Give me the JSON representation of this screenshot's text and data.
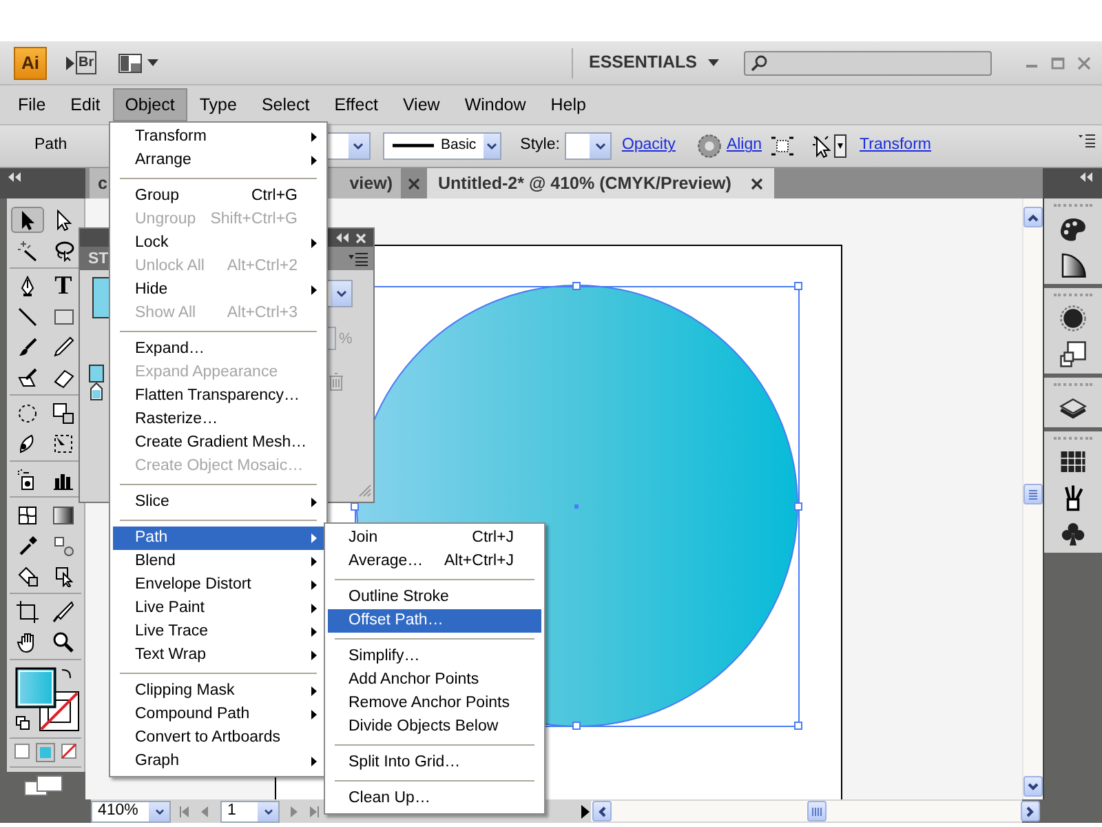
{
  "app_bar": {
    "logo": "Ai",
    "bridge": "Br",
    "workspace": "ESSENTIALS"
  },
  "menu_bar": [
    {
      "label": "File",
      "selected": false
    },
    {
      "label": "Edit",
      "selected": false
    },
    {
      "label": "Object",
      "selected": true
    },
    {
      "label": "Type",
      "selected": false
    },
    {
      "label": "Select",
      "selected": false
    },
    {
      "label": "Effect",
      "selected": false
    },
    {
      "label": "View",
      "selected": false
    },
    {
      "label": "Window",
      "selected": false
    },
    {
      "label": "Help",
      "selected": false
    }
  ],
  "control_bar": {
    "selection": "Path",
    "stroke_style": "Basic",
    "style_label": "Style:",
    "links": [
      "Opacity",
      "Align",
      "Transform"
    ]
  },
  "doc_tabs": [
    {
      "label_start": "c",
      "label_end": "view)",
      "selected": false
    },
    {
      "label": "Untitled-2* @ 410% (CMYK/Preview)",
      "selected": true
    }
  ],
  "type_tool_glyph": "T",
  "floating_panel": {
    "title": "ST",
    "percent_sign": "%"
  },
  "object_menu": [
    {
      "kind": "item",
      "label": "Transform",
      "submenu": true,
      "disabled": false,
      "selected": false
    },
    {
      "kind": "item",
      "label": "Arrange",
      "submenu": true,
      "disabled": false,
      "selected": false
    },
    {
      "kind": "separator"
    },
    {
      "kind": "item",
      "label": "Group",
      "shortcut": "Ctrl+G",
      "submenu": false,
      "disabled": false,
      "selected": false
    },
    {
      "kind": "item",
      "label": "Ungroup",
      "shortcut": "Shift+Ctrl+G",
      "submenu": false,
      "disabled": true,
      "selected": false
    },
    {
      "kind": "item",
      "label": "Lock",
      "submenu": true,
      "disabled": false,
      "selected": false
    },
    {
      "kind": "item",
      "label": "Unlock All",
      "shortcut": "Alt+Ctrl+2",
      "submenu": false,
      "disabled": true,
      "selected": false
    },
    {
      "kind": "item",
      "label": "Hide",
      "submenu": true,
      "disabled": false,
      "selected": false
    },
    {
      "kind": "item",
      "label": "Show All",
      "shortcut": "Alt+Ctrl+3",
      "submenu": false,
      "disabled": true,
      "selected": false
    },
    {
      "kind": "separator"
    },
    {
      "kind": "item",
      "label": "Expand…",
      "submenu": false,
      "disabled": false,
      "selected": false
    },
    {
      "kind": "item",
      "label": "Expand Appearance",
      "submenu": false,
      "disabled": true,
      "selected": false
    },
    {
      "kind": "item",
      "label": "Flatten Transparency…",
      "submenu": false,
      "disabled": false,
      "selected": false
    },
    {
      "kind": "item",
      "label": "Rasterize…",
      "submenu": false,
      "disabled": false,
      "selected": false
    },
    {
      "kind": "item",
      "label": "Create Gradient Mesh…",
      "submenu": false,
      "disabled": false,
      "selected": false
    },
    {
      "kind": "item",
      "label": "Create Object Mosaic…",
      "submenu": false,
      "disabled": true,
      "selected": false
    },
    {
      "kind": "separator"
    },
    {
      "kind": "item",
      "label": "Slice",
      "submenu": true,
      "disabled": false,
      "selected": false
    },
    {
      "kind": "separator"
    },
    {
      "kind": "item",
      "label": "Path",
      "submenu": true,
      "disabled": false,
      "selected": true
    },
    {
      "kind": "item",
      "label": "Blend",
      "submenu": true,
      "disabled": false,
      "selected": false
    },
    {
      "kind": "item",
      "label": "Envelope Distort",
      "submenu": true,
      "disabled": false,
      "selected": false
    },
    {
      "kind": "item",
      "label": "Live Paint",
      "submenu": true,
      "disabled": false,
      "selected": false
    },
    {
      "kind": "item",
      "label": "Live Trace",
      "submenu": true,
      "disabled": false,
      "selected": false
    },
    {
      "kind": "item",
      "label": "Text Wrap",
      "submenu": true,
      "disabled": false,
      "selected": false
    },
    {
      "kind": "separator"
    },
    {
      "kind": "item",
      "label": "Clipping Mask",
      "submenu": true,
      "disabled": false,
      "selected": false
    },
    {
      "kind": "item",
      "label": "Compound Path",
      "submenu": true,
      "disabled": false,
      "selected": false
    },
    {
      "kind": "item",
      "label": "Convert to Artboards",
      "submenu": false,
      "disabled": false,
      "selected": false
    },
    {
      "kind": "item",
      "label": "Graph",
      "submenu": true,
      "disabled": false,
      "selected": false
    }
  ],
  "path_submenu": [
    {
      "kind": "item",
      "label": "Join",
      "shortcut": "Ctrl+J",
      "submenu": false,
      "disabled": false,
      "selected": false
    },
    {
      "kind": "item",
      "label": "Average…",
      "shortcut": "Alt+Ctrl+J",
      "submenu": false,
      "disabled": false,
      "selected": false
    },
    {
      "kind": "separator"
    },
    {
      "kind": "item",
      "label": "Outline Stroke",
      "submenu": false,
      "disabled": false,
      "selected": false
    },
    {
      "kind": "item",
      "label": "Offset Path…",
      "submenu": false,
      "disabled": false,
      "selected": true
    },
    {
      "kind": "separator"
    },
    {
      "kind": "item",
      "label": "Simplify…",
      "submenu": false,
      "disabled": false,
      "selected": false
    },
    {
      "kind": "item",
      "label": "Add Anchor Points",
      "submenu": false,
      "disabled": false,
      "selected": false
    },
    {
      "kind": "item",
      "label": "Remove Anchor Points",
      "submenu": false,
      "disabled": false,
      "selected": false
    },
    {
      "kind": "item",
      "label": "Divide Objects Below",
      "submenu": false,
      "disabled": false,
      "selected": false
    },
    {
      "kind": "separator"
    },
    {
      "kind": "item",
      "label": "Split Into Grid…",
      "submenu": false,
      "disabled": false,
      "selected": false
    },
    {
      "kind": "separator"
    },
    {
      "kind": "item",
      "label": "Clean Up…",
      "submenu": false,
      "disabled": false,
      "selected": false
    }
  ],
  "status_bar": {
    "zoom": "410%",
    "page": "1"
  }
}
